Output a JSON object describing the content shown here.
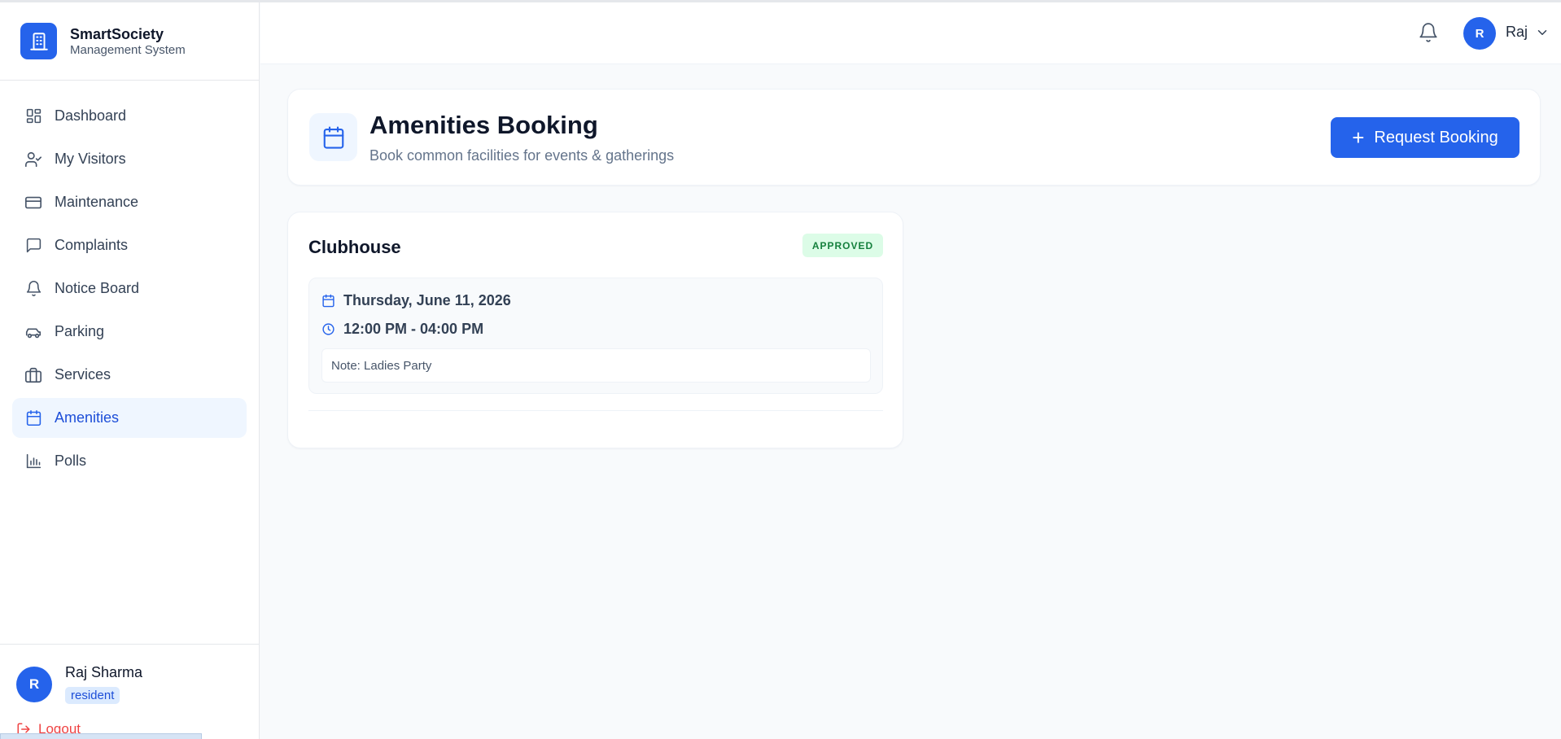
{
  "brand": {
    "title": "SmartSociety",
    "subtitle": "Management System",
    "icon": "building-icon",
    "color": "#2563eb"
  },
  "sidebar": {
    "items": [
      {
        "label": "Dashboard",
        "icon": "dashboard-icon",
        "active": false
      },
      {
        "label": "My Visitors",
        "icon": "user-check-icon",
        "active": false
      },
      {
        "label": "Maintenance",
        "icon": "credit-card-icon",
        "active": false
      },
      {
        "label": "Complaints",
        "icon": "message-square-icon",
        "active": false
      },
      {
        "label": "Notice Board",
        "icon": "bell-icon",
        "active": false
      },
      {
        "label": "Parking",
        "icon": "car-icon",
        "active": false
      },
      {
        "label": "Services",
        "icon": "briefcase-icon",
        "active": false
      },
      {
        "label": "Amenities",
        "icon": "calendar-icon",
        "active": true
      },
      {
        "label": "Polls",
        "icon": "bar-chart-icon",
        "active": false
      }
    ]
  },
  "user": {
    "initial": "R",
    "name": "Raj Sharma",
    "role": "resident",
    "logout_label": "Logout"
  },
  "header": {
    "avatar_initial": "R",
    "user_short_name": "Raj"
  },
  "page": {
    "title": "Amenities Booking",
    "subtitle": "Book common facilities for events & gatherings",
    "request_button": "Request Booking"
  },
  "bookings": [
    {
      "amenity": "Clubhouse",
      "status": "APPROVED",
      "date": "Thursday, June 11, 2026",
      "time": "12:00 PM - 04:00 PM",
      "note": "Note: Ladies Party"
    }
  ],
  "colors": {
    "accent": "#2563eb",
    "approved_bg": "#dcfce7",
    "approved_text": "#15803d",
    "logout": "#ef4444"
  }
}
